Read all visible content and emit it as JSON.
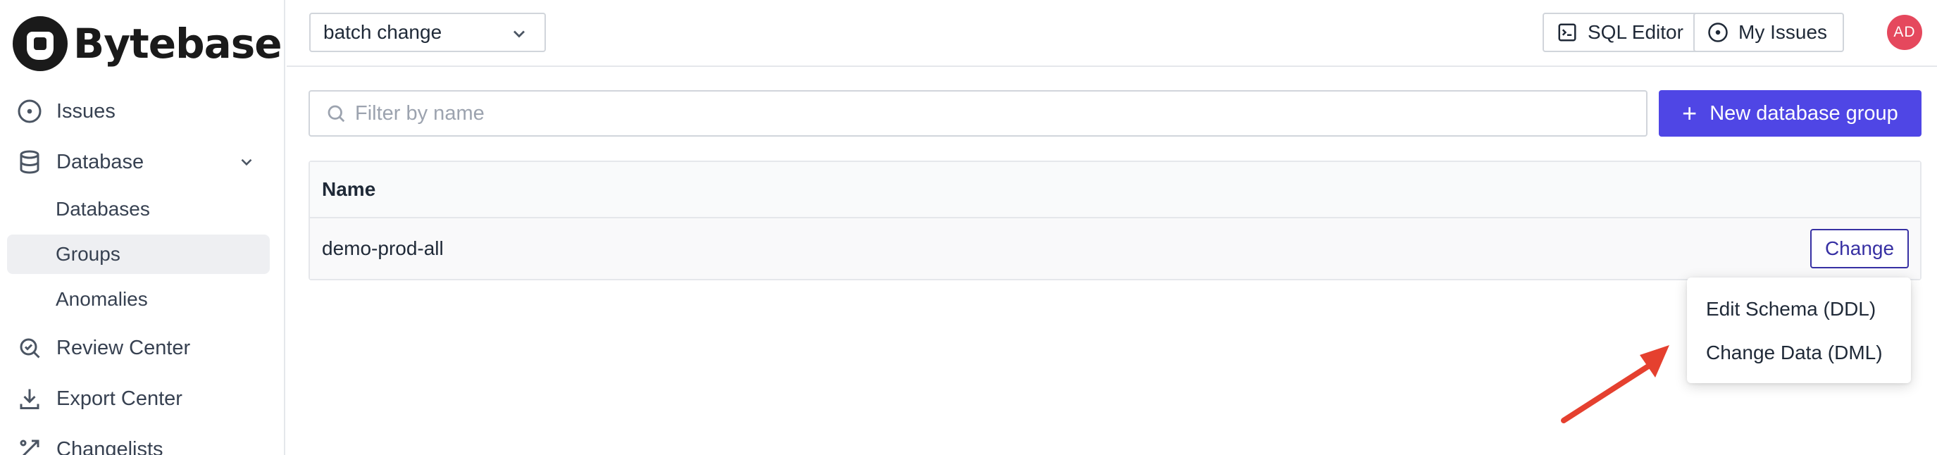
{
  "sidebar": {
    "logo_text": "Bytebase",
    "items": [
      {
        "label": "Issues",
        "icon": "circle-dot-icon"
      },
      {
        "label": "Database",
        "icon": "database-icon"
      },
      {
        "label": "Review Center",
        "icon": "search-review-icon"
      },
      {
        "label": "Export Center",
        "icon": "download-icon"
      },
      {
        "label": "Changelists",
        "icon": "changelist-icon"
      }
    ],
    "database_sub": [
      {
        "label": "Databases"
      },
      {
        "label": "Groups",
        "active": true
      },
      {
        "label": "Anomalies"
      }
    ]
  },
  "header": {
    "project_select": "batch change",
    "sql_editor": "SQL Editor",
    "my_issues": "My Issues",
    "avatar_initials": "AD"
  },
  "main": {
    "filter_placeholder": "Filter by name",
    "new_group_button": "New database group",
    "table": {
      "columns": [
        "Name"
      ],
      "rows": [
        {
          "name": "demo-prod-all",
          "action": "Change"
        }
      ]
    },
    "change_menu": [
      "Edit Schema (DDL)",
      "Change Data (DML)"
    ]
  },
  "colors": {
    "accent": "#4f46e5",
    "avatar": "#e5485d",
    "annotation_arrow": "#e5402f"
  }
}
